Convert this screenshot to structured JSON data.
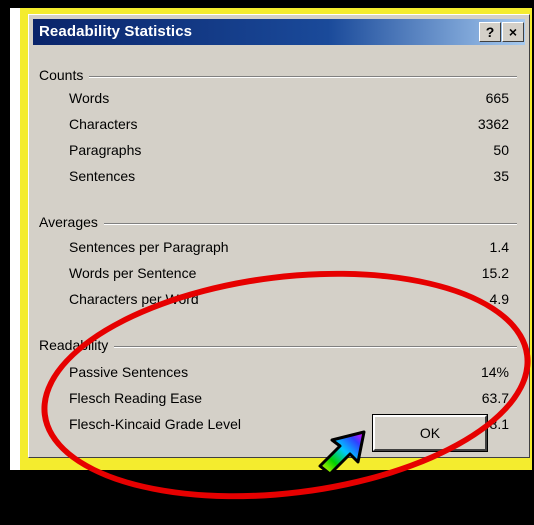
{
  "dialog": {
    "title": "Readability Statistics",
    "help_button": "?",
    "close_button": "×",
    "ok_label": "OK"
  },
  "groups": {
    "counts": {
      "label": "Counts",
      "rows": [
        {
          "label": "Words",
          "value": "665"
        },
        {
          "label": "Characters",
          "value": "3362"
        },
        {
          "label": "Paragraphs",
          "value": "50"
        },
        {
          "label": "Sentences",
          "value": "35"
        }
      ]
    },
    "averages": {
      "label": "Averages",
      "rows": [
        {
          "label": "Sentences per Paragraph",
          "value": "1.4"
        },
        {
          "label": "Words per Sentence",
          "value": "15.2"
        },
        {
          "label": "Characters per Word",
          "value": "4.9"
        }
      ]
    },
    "readability": {
      "label": "Readability",
      "rows": [
        {
          "label": "Passive Sentences",
          "value": "14%"
        },
        {
          "label": "Flesch Reading Ease",
          "value": "63.7"
        },
        {
          "label": "Flesch-Kincaid Grade Level",
          "value": "8.1"
        }
      ]
    }
  },
  "colors": {
    "frame_yellow": "#f4ec2e",
    "titlebar": "#0a246a",
    "dialog_face": "#d4d0c8",
    "annotation_circle": "#e60000"
  },
  "icons": {
    "pointer": "rainbow-arrow-icon"
  }
}
